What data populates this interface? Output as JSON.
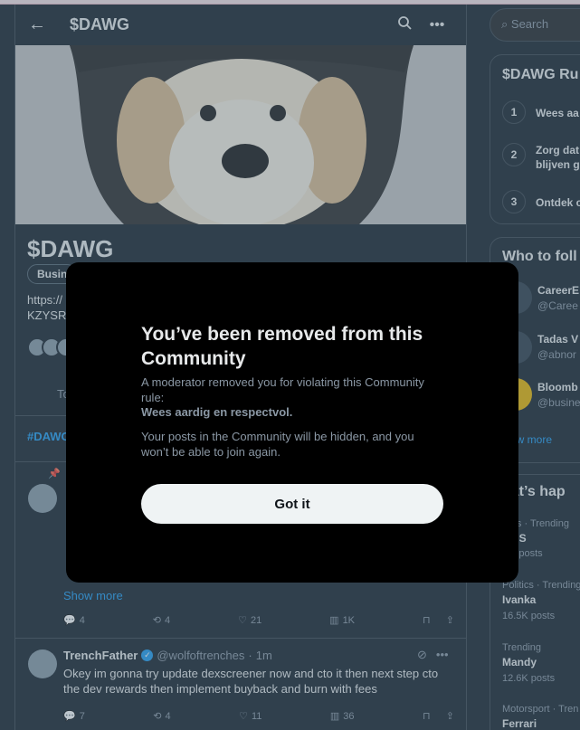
{
  "header": {
    "title": "$DAWG"
  },
  "community": {
    "name": "$DAWG",
    "category_pill": "Busin",
    "description_line1": "https://",
    "description_line2": "KZYSR"
  },
  "tabs": {
    "top_label": "To"
  },
  "hashtag": "#DAWG",
  "posts": [
    {
      "show_more": "Show more",
      "stats": {
        "replies": "4",
        "reposts": "4",
        "likes": "21",
        "views": "1K"
      }
    },
    {
      "author": "TrenchFather",
      "handle": "@wolfoftrenches",
      "time": "1m",
      "text": "Okey im gonna try update dexscreener now and cto it then next step cto the dev rewards then implement buyback and burn with fees",
      "stats": {
        "replies": "7",
        "reposts": "4",
        "likes": "11",
        "views": "36"
      }
    }
  ],
  "sidebar": {
    "search_placeholder": "Search",
    "rules_title": "$DAWG Ru",
    "rules": [
      {
        "num": "1",
        "text": "Wees aa"
      },
      {
        "num": "2",
        "text": "Zorg dat",
        "text2": "blijven g"
      },
      {
        "num": "3",
        "text": "Ontdek c"
      }
    ],
    "who_title": "Who to foll",
    "who": [
      {
        "name": "CareerE",
        "handle": "@Caree"
      },
      {
        "name": "Tadas V",
        "handle": "@abnor"
      },
      {
        "name": "Bloomb",
        "handle": "@busine"
      }
    ],
    "show_more": "ow more",
    "trends_title": "hat’s hap",
    "trends": [
      {
        "category": "litics · Trending",
        "name": "e US",
        "count": "3M posts"
      },
      {
        "category": "Politics · Trending",
        "name": "Ivanka",
        "count": "16.5K posts"
      },
      {
        "category": "Trending",
        "name": "Mandy",
        "count": "12.6K posts"
      },
      {
        "category": "Motorsport · Tren",
        "name": "Ferrari",
        "count": ""
      }
    ]
  },
  "modal": {
    "title": "You’ve been removed from this Community",
    "text1": "A moderator removed you for violating this Community rule:",
    "rule": "Wees aardig en respectvol.",
    "text2": "Your posts in the Community will be hidden, and you won’t be able to join again.",
    "button": "Got it"
  },
  "colors": {
    "background": "#15202b",
    "accent": "#1d9bf0",
    "modal": "#000000",
    "button": "#eff3f4"
  }
}
